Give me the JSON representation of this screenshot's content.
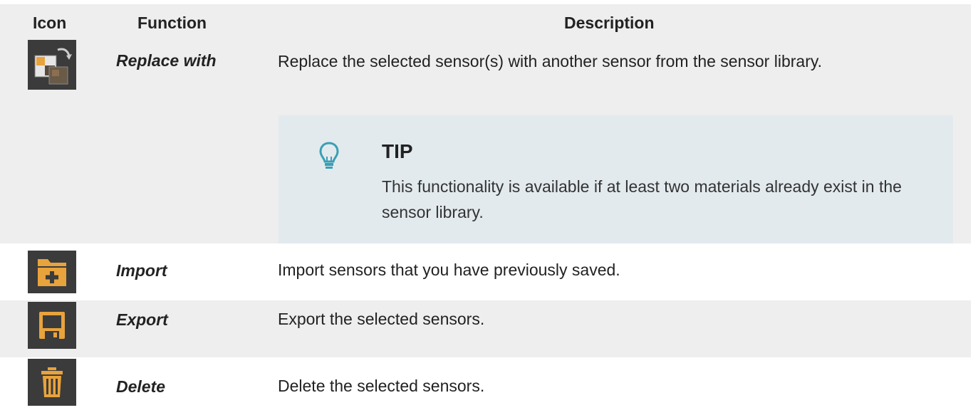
{
  "header": {
    "icon": "Icon",
    "function": "Function",
    "description": "Description"
  },
  "rows": [
    {
      "icon_name": "replace-icon",
      "function": "Replace with",
      "description": "Replace the selected sensor(s) with another sensor from the sensor library."
    },
    {
      "icon_name": "import-folder-icon",
      "function": "Import",
      "description": "Import sensors that you have previously saved."
    },
    {
      "icon_name": "save-disk-icon",
      "function": "Export",
      "description": "Export the selected sensors."
    },
    {
      "icon_name": "trash-icon",
      "function": "Delete",
      "description": "Delete the selected sensors."
    }
  ],
  "tip": {
    "icon_name": "lightbulb-icon",
    "title": "TIP",
    "body": "This functionality is available if at least two materials already exist in the sensor library."
  },
  "colors": {
    "row_shade": "#eeeeee",
    "tip_background": "#e2eaee",
    "tip_icon": "#3a9fb5",
    "icon_background": "#3b3b3b",
    "icon_accent": "#e8a33c"
  }
}
